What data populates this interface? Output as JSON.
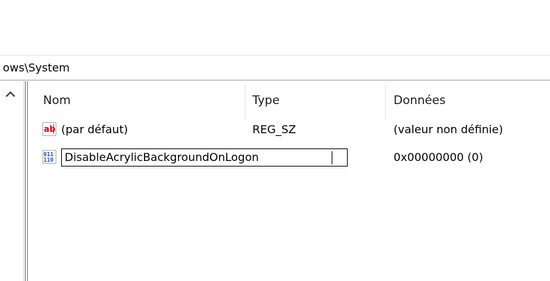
{
  "address": {
    "path": "ows\\System"
  },
  "list": {
    "columns": [
      "Nom",
      "Type",
      "Données"
    ],
    "rows": [
      {
        "name": "(par défaut)",
        "type": "REG_SZ",
        "data": "(valeur non définie)",
        "icon": "string-value-icon"
      },
      {
        "name": "DisableAcrylicBackgroundOnLogon",
        "type": "",
        "data": "0x00000000 (0)",
        "icon": "binary-value-icon"
      }
    ]
  },
  "rename": {
    "value": "DisableAcrylicBackgroundOnLogon"
  },
  "colors": {
    "ab_icon_red": "#d0021b",
    "bin_icon_blue": "#1f4e9c"
  }
}
